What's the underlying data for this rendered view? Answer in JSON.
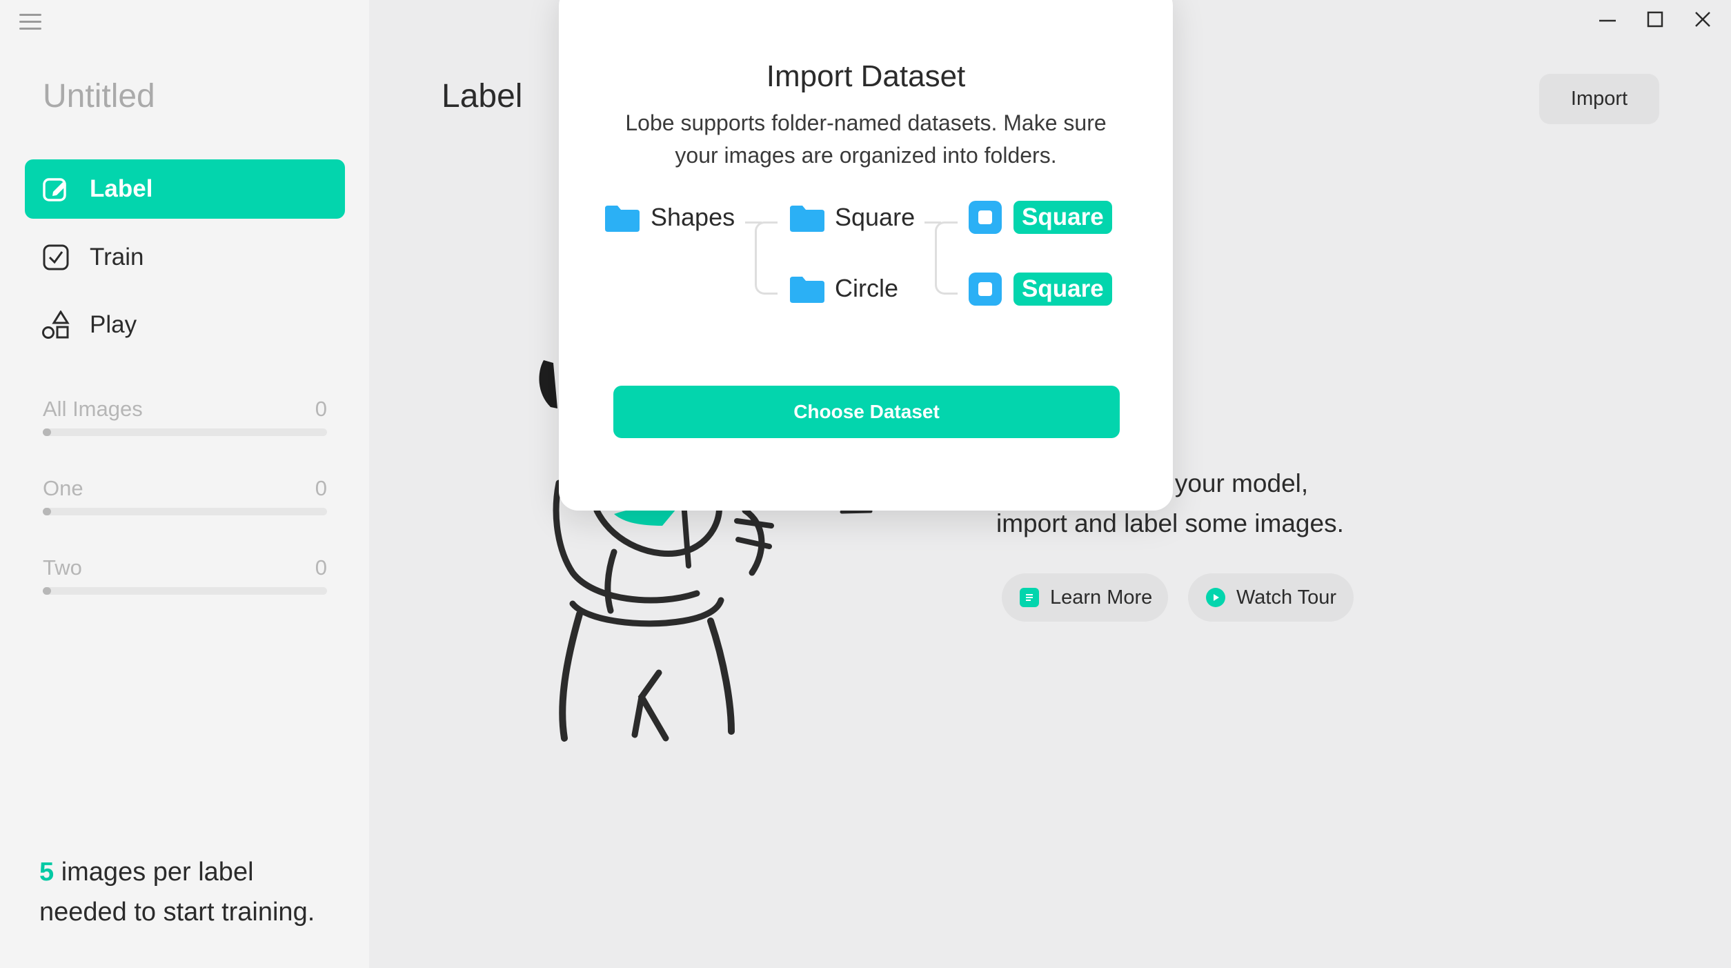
{
  "app": {
    "project_title": "Untitled"
  },
  "sidebar": {
    "nav": [
      {
        "label": "Label",
        "icon": "edit-icon",
        "active": true
      },
      {
        "label": "Train",
        "icon": "checkbox-icon",
        "active": false
      },
      {
        "label": "Play",
        "icon": "shapes-icon",
        "active": false
      }
    ],
    "stats": [
      {
        "label": "All Images",
        "count": "0"
      },
      {
        "label": "One",
        "count": "0"
      },
      {
        "label": "Two",
        "count": "0"
      }
    ],
    "hint": {
      "count": "5",
      "line1": " images per label",
      "line2": "needed to start training."
    }
  },
  "main": {
    "title": "Label",
    "import_label": "Import",
    "empty_text_line1": "g your model,",
    "empty_text_line2": "import and label some images.",
    "learn_more_label": "Learn More",
    "watch_tour_label": "Watch Tour"
  },
  "modal": {
    "title": "Import Dataset",
    "desc_line1": "Lobe supports folder-named datasets. Make sure",
    "desc_line2": "your images are organized into folders.",
    "tree": {
      "root": "Shapes",
      "folder1": "Square",
      "folder2": "Circle",
      "tag1": "Square",
      "tag2": "Square"
    },
    "choose_label": "Choose Dataset"
  },
  "colors": {
    "accent": "#03d5ad",
    "folder": "#2bb0f5",
    "background": "#ececed",
    "sidebar": "#f4f4f4"
  }
}
